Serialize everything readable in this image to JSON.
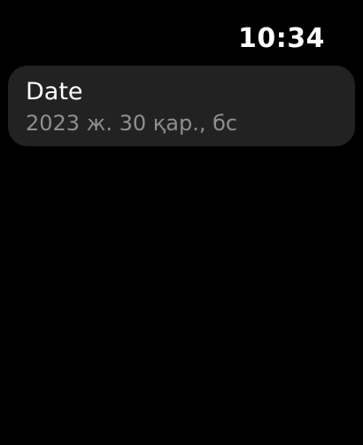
{
  "status_bar": {
    "time": "10:34"
  },
  "list": {
    "items": [
      {
        "title": "Date",
        "detail": "2023 ж. 30 қар., бс"
      }
    ]
  },
  "colors": {
    "background": "#000000",
    "cell_background": "#222222",
    "title_text": "#ffffff",
    "detail_text": "#8e8e93"
  }
}
